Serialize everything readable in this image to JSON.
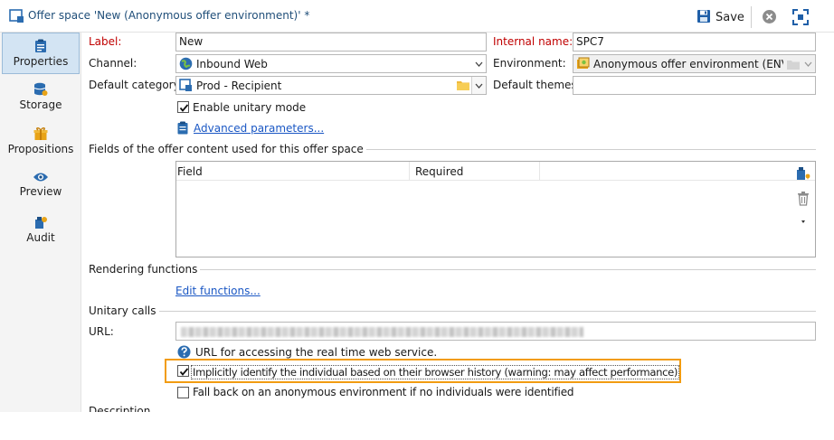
{
  "window": {
    "title": "Offer space 'New (Anonymous offer environment)' *",
    "save_label": "Save"
  },
  "sidebar": {
    "items": [
      {
        "label": "Properties",
        "icon": "clipboard-icon",
        "active": true
      },
      {
        "label": "Storage",
        "icon": "database-icon",
        "active": false
      },
      {
        "label": "Propositions",
        "icon": "gift-icon",
        "active": false
      },
      {
        "label": "Preview",
        "icon": "eye-icon",
        "active": false
      },
      {
        "label": "Audit",
        "icon": "audit-icon",
        "active": false
      }
    ]
  },
  "form": {
    "label_label": "Label:",
    "label_value": "New",
    "internal_name_label": "Internal name:",
    "internal_name_value": "SPC7",
    "channel_label": "Channel:",
    "channel_value": "Inbound Web",
    "environment_label": "Environment:",
    "environment_value": "Anonymous offer environment (ENV_DE",
    "default_category_label": "Default category:",
    "default_category_value": "Prod - Recipient",
    "default_themes_label": "Default themes:",
    "default_themes_value": "",
    "enable_unitary_label": "Enable unitary mode",
    "enable_unitary_checked": true,
    "advanced_parameters_link": "Advanced parameters..."
  },
  "fields_section": {
    "title": "Fields of the offer content used for this offer space",
    "columns": [
      "Field",
      "Required"
    ],
    "rows": []
  },
  "rendering": {
    "title": "Rendering functions",
    "edit_link": "Edit functions..."
  },
  "unitary_calls": {
    "title": "Unitary calls",
    "url_label": "URL:",
    "url_help": "URL for accessing the real time web service.",
    "implicit_identify_label": "Implicitly identify the individual based on their browser history (warning: may affect performance)",
    "implicit_identify_checked": true,
    "fallback_label": "Fall back on an anonymous environment if no individuals were identified",
    "fallback_checked": false
  },
  "description": {
    "title": "Description"
  },
  "colors": {
    "accent": "#1a57c4",
    "required_label": "#c00000",
    "highlight": "#f29c11",
    "sidebar_active": "#d3e4f3"
  }
}
